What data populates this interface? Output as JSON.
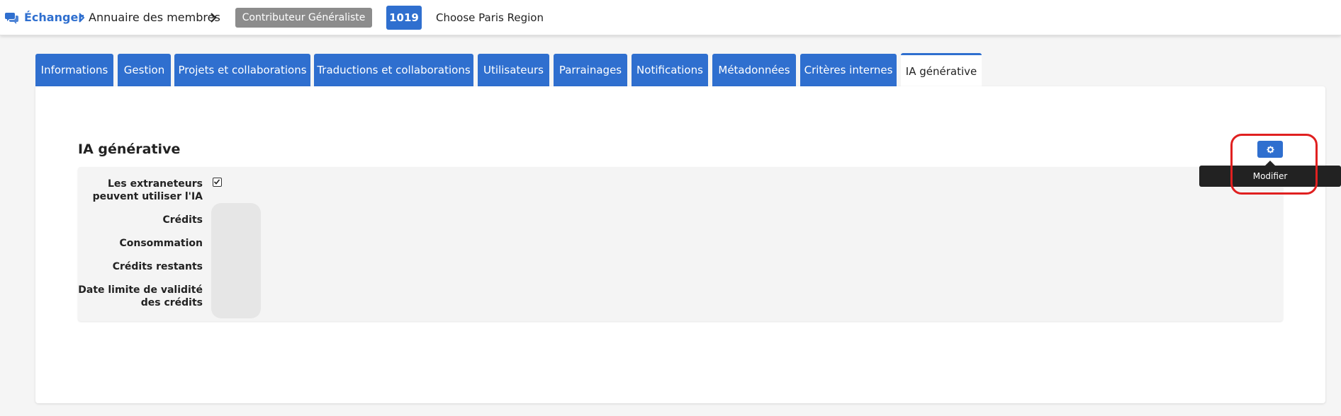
{
  "header": {
    "breadcrumb_root": "Échanger",
    "breadcrumb_child": "Annuaire des membres",
    "role_badge": "Contributeur Généraliste",
    "id_badge": "1019",
    "organization": "Choose Paris Region",
    "icons": [
      "chat-bubbles-icon",
      "chevron-right-icon"
    ],
    "accent_color": "#2f6fcf"
  },
  "tabs": [
    {
      "label": "Informations"
    },
    {
      "label": "Gestion"
    },
    {
      "label": "Projets et collaborations"
    },
    {
      "label": "Traductions et collaborations"
    },
    {
      "label": "Utilisateurs"
    },
    {
      "label": "Parrainages"
    },
    {
      "label": "Notifications"
    },
    {
      "label": "Métadonnées"
    },
    {
      "label": "Critères internes"
    },
    {
      "label": "IA générative",
      "active": true
    }
  ],
  "section": {
    "title": "IA générative",
    "fields": [
      {
        "label": "Les extraneteurs peuvent utiliser l'IA",
        "value": "checked"
      },
      {
        "label": "Crédits",
        "value": ""
      },
      {
        "label": "Consommation",
        "value": ""
      },
      {
        "label": "Crédits restants",
        "value": ""
      },
      {
        "label": "Date limite de validité des crédits",
        "value": ""
      }
    ]
  },
  "edit": {
    "icon": "gear-icon",
    "tooltip": "Modifier",
    "highlight_color": "#e02020"
  }
}
